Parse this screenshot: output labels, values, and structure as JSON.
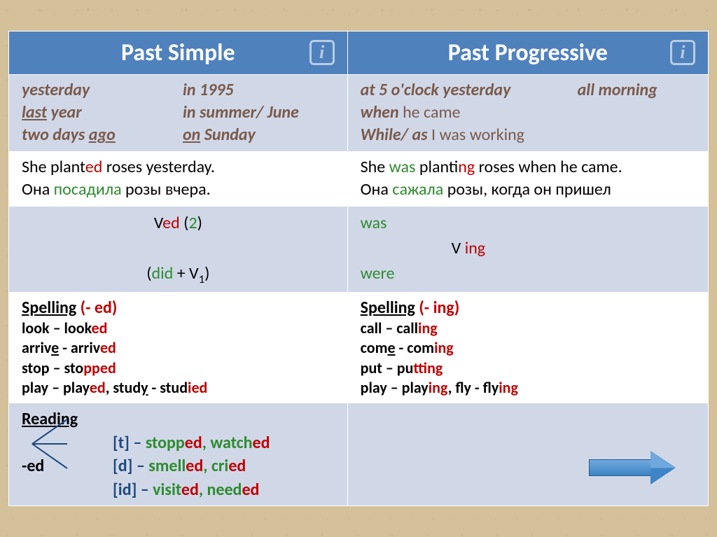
{
  "header": {
    "left": "Past Simple",
    "right": "Past Progressive",
    "info": "i"
  },
  "markers": {
    "left": {
      "l1a": "yesterday",
      "l1b": "in 1995",
      "l2a_pre": "last",
      "l2a_u": "last",
      "l2a_post": " year",
      "l2b": "in summer/ June",
      "l3a_pre": "two days ",
      "l3a_u": "ago",
      "l3b_pre": "on",
      "l3b_post": " Sunday"
    },
    "right": {
      "l1a": "at 5 o'clock  yesterday",
      "l1b": "all morning",
      "l2a": "when ",
      "l2b": "he came",
      "l3a": "While/ as ",
      "l3b": "I was working"
    }
  },
  "examples": {
    "left": {
      "en_pre": "She  plant",
      "en_ed": "ed",
      "en_post": " roses yesterday.",
      "ru_pre": "Она ",
      "ru_g": "посадила",
      "ru_post": " розы вчера."
    },
    "right": {
      "en_1": "She ",
      "en_was": "was",
      "en_2": " plant",
      "en_ing": "ing",
      "en_3": " roses when he came.",
      "ru_pre": "Она ",
      "ru_g": "сажала",
      "ru_post": " розы, когда он пришел"
    }
  },
  "formula": {
    "left": {
      "ved_v": "V",
      "ved_ed": "ed",
      "ved_open": " (",
      "ved_2": "2",
      "ved_close": ")",
      "did_open": "(",
      "did": "did",
      "did_plus": " + V",
      "did_1": "1",
      "did_close": ")"
    },
    "right": {
      "was": "was",
      "v": "V ",
      "ing": "ing",
      "were": "were"
    }
  },
  "spelling": {
    "left": {
      "title_a": "Spelling",
      "title_b": "  (- ed)",
      "l1a": "look – look",
      "l1b": "ed",
      "l2a": "arriv",
      "l2u": "e",
      "l2b": " - arriv",
      "l2c": "ed",
      "l3a": "stop – sto",
      "l3b": "pp",
      "l3c": "ed",
      "l4a": "play – play",
      "l4b": "ed",
      "l4c": ", stud",
      "l4u": "y",
      "l4d": " - stud",
      "l4e": "i",
      "l4f": "ed"
    },
    "right": {
      "title_a": "Spelling",
      "title_b": "  (- ing)",
      "l1a": "call – call",
      "l1b": "ing",
      "l2a": "com",
      "l2u": "e",
      "l2b": " - com",
      "l2c": "ing",
      "l3a": "put – pu",
      "l3b": "tt",
      "l3c": "ing",
      "l4a": "play – play",
      "l4b": "ing",
      "l4c": ", fly - fly",
      "l4d": "ing"
    }
  },
  "reading": {
    "title": "Reading",
    "ed": "-ed",
    "r1a": "[t] – ",
    "r1b": "stopp",
    "r1c": "ed",
    "r1d": ", watch",
    "r1e": "ed",
    "r2a": "[d] – ",
    "r2b": "smell",
    "r2c": "ed",
    "r2d": ", cri",
    "r2e": "ed",
    "r3a": "[id] – ",
    "r3b": "visit",
    "r3c": "ed",
    "r3d": ", need",
    "r3e": "ed"
  }
}
